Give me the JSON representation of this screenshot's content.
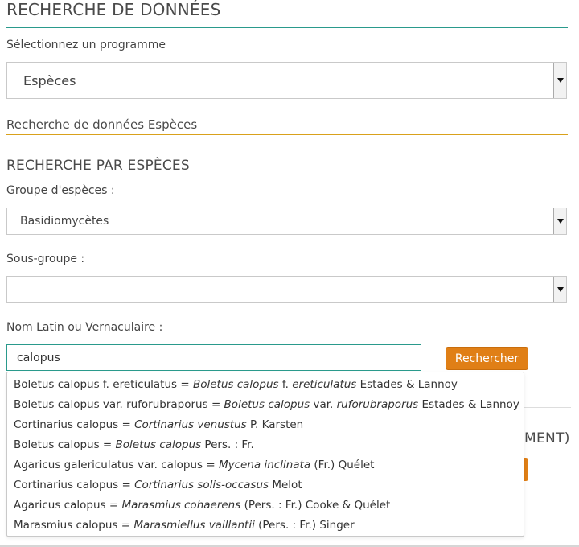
{
  "page_title": "RECHERCHE DE DONNÉES",
  "program": {
    "label": "Sélectionnez un programme",
    "selected": "Espèces"
  },
  "subheading": "Recherche de données Espèces",
  "species_search": {
    "title": "RECHERCHE PAR ESPÈCES",
    "group_label": "Groupe d'espèces :",
    "group_selected": "Basidiomycètes",
    "subgroup_label": "Sous-groupe :",
    "subgroup_selected": "",
    "name_label": "Nom Latin ou Vernaculaire :",
    "name_value": "calopus",
    "search_button": "Rechercher"
  },
  "hidden_section": {
    "heading_fragment": "MENT)"
  },
  "suggestions": [
    {
      "prefix": "Boletus calopus f. ereticulatus = ",
      "parts": [
        [
          "Boletus calopus",
          true
        ],
        [
          " f. ",
          false
        ],
        [
          "ereticulatus",
          true
        ],
        [
          " Estades & Lannoy",
          false
        ]
      ]
    },
    {
      "prefix": "Boletus calopus var. ruforubraporus = ",
      "parts": [
        [
          "Boletus calopus",
          true
        ],
        [
          " var. ",
          false
        ],
        [
          "ruforubraporus",
          true
        ],
        [
          " Estades & Lannoy",
          false
        ]
      ]
    },
    {
      "prefix": "Cortinarius calopus = ",
      "parts": [
        [
          "Cortinarius venustus",
          true
        ],
        [
          " P. Karsten",
          false
        ]
      ]
    },
    {
      "prefix": "Boletus calopus = ",
      "parts": [
        [
          "Boletus calopus",
          true
        ],
        [
          " Pers. : Fr.",
          false
        ]
      ]
    },
    {
      "prefix": "Agaricus galericulatus var. calopus = ",
      "parts": [
        [
          "Mycena inclinata",
          true
        ],
        [
          " (Fr.) Quélet",
          false
        ]
      ]
    },
    {
      "prefix": "Cortinarius calopus = ",
      "parts": [
        [
          "Cortinarius solis-occasus",
          true
        ],
        [
          " Melot",
          false
        ]
      ]
    },
    {
      "prefix": "Agaricus calopus = ",
      "parts": [
        [
          "Marasmius cohaerens",
          true
        ],
        [
          " (Pers. : Fr.) Cooke & Quélet",
          false
        ]
      ]
    },
    {
      "prefix": "Marasmius calopus = ",
      "parts": [
        [
          "Marasmiellus vaillantii",
          true
        ],
        [
          " (Pers. : Fr.) Singer",
          false
        ]
      ]
    }
  ],
  "colors": {
    "teal": "#2a9a8c",
    "gold": "#d9a11b",
    "button_orange": "#e07f16"
  }
}
